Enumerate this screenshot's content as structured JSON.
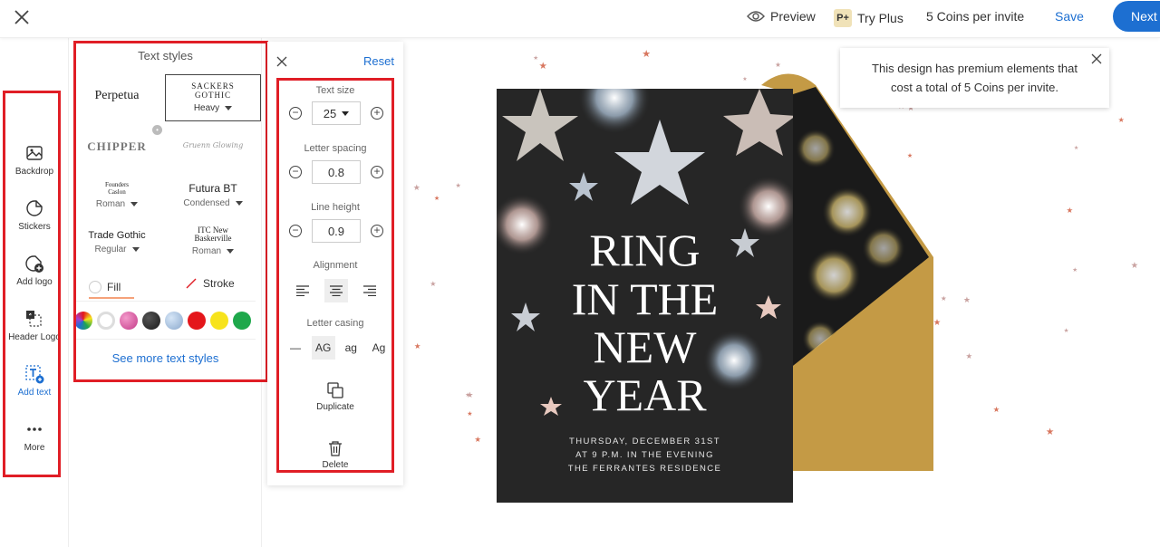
{
  "topbar": {
    "preview": "Preview",
    "plus_badge": "P+",
    "try_plus": "Try Plus",
    "coins": "5 Coins per invite",
    "save": "Save",
    "next": "Next"
  },
  "rail": {
    "items": [
      {
        "label": "Backdrop",
        "icon": "backdrop-icon"
      },
      {
        "label": "Stickers",
        "icon": "sticker-icon"
      },
      {
        "label": "Add logo",
        "icon": "add-logo-icon"
      },
      {
        "label": "Header Logo",
        "icon": "header-logo-icon"
      },
      {
        "label": "Add text",
        "icon": "add-text-icon"
      },
      {
        "label": "More",
        "icon": "more-icon"
      }
    ]
  },
  "text_styles": {
    "title": "Text styles",
    "fonts": [
      {
        "name": "Perpetua",
        "sub": ""
      },
      {
        "name": "Sackers Gothic",
        "sub": "Heavy"
      },
      {
        "name": "CHIPPER",
        "sub": ""
      },
      {
        "name": "Gruenn Glowing",
        "sub": ""
      },
      {
        "name": "Founders Caslon",
        "sub": "Roman"
      },
      {
        "name": "Futura BT",
        "sub": "Condensed"
      },
      {
        "name": "Trade Gothic",
        "sub": "Regular"
      },
      {
        "name": "ITC New Baskerville",
        "sub": "Roman"
      }
    ],
    "fill_label": "Fill",
    "stroke_label": "Stroke",
    "swatch_colors": [
      "#multicolor",
      "#ffffff",
      "#d25aa0",
      "#2b2b2b",
      "#a9c4e2",
      "#e4161b",
      "#f7e31c",
      "#1ea84b"
    ],
    "see_more": "See more text styles"
  },
  "props": {
    "reset": "Reset",
    "text_size_label": "Text size",
    "text_size": "25",
    "letter_spacing_label": "Letter spacing",
    "letter_spacing": "0.8",
    "line_height_label": "Line height",
    "line_height": "0.9",
    "alignment_label": "Alignment",
    "letter_casing_label": "Letter casing",
    "casing_options": [
      "—",
      "AG",
      "ag",
      "Ag"
    ],
    "duplicate": "Duplicate",
    "delete": "Delete"
  },
  "card": {
    "title_lines": [
      "RING",
      "IN THE",
      "NEW",
      "YEAR"
    ],
    "details": [
      "THURSDAY, DECEMBER 31ST",
      "AT 9 P.M. IN THE EVENING",
      "THE FERRANTES RESIDENCE"
    ]
  },
  "notice": {
    "text": "This design has premium elements that cost a total of 5 Coins per invite."
  }
}
